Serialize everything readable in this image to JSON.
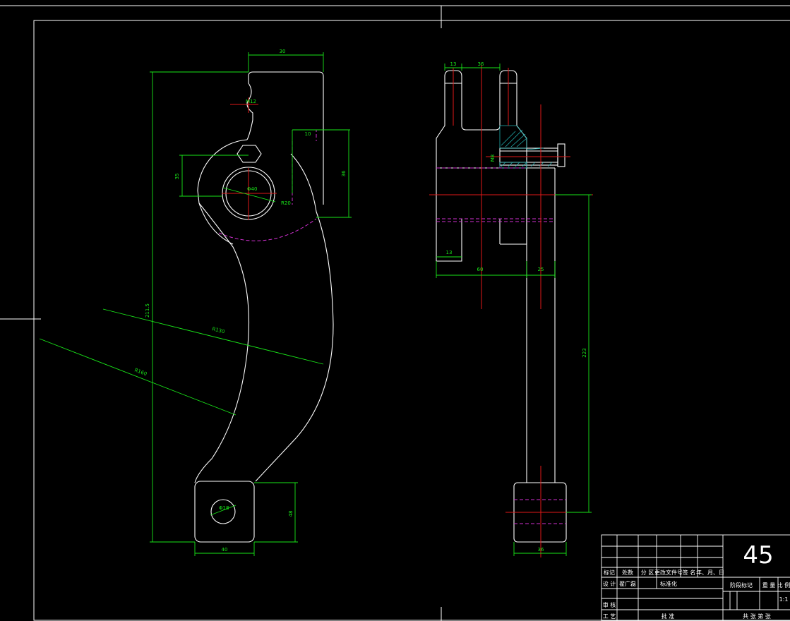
{
  "colors": {
    "background": "#000000",
    "outline": "#ffffff",
    "dimension": "#19e619",
    "centerline": "#e01818",
    "hidden": "#d030d0",
    "hatch": "#20b0b0"
  },
  "front_view": {
    "dims": {
      "top_width": "30",
      "height_overall": "211.5",
      "slot_depth": "10",
      "slot_height": "36",
      "bore_offset": "35",
      "bore_dia": "Φ40",
      "bore_r": "R20",
      "hole_m": "M12",
      "radius_arc_1": "R130",
      "radius_arc_2": "R160",
      "pad_height": "48",
      "pad_width": "40",
      "pad_hole": "Φ18"
    }
  },
  "side_view": {
    "dims": {
      "ear_width": "13",
      "gap_width": "36",
      "fork_width": "60",
      "shank_width": "25",
      "thread": "M8",
      "base_width": "13",
      "shank_length": "223",
      "pad_width": "36"
    }
  },
  "title_block": {
    "material": "45",
    "header_labels": [
      "标记",
      "处数",
      "分 区",
      "更改文件号",
      "签 名",
      "年、月、日"
    ],
    "design_label": "设 计",
    "designer": "翟广磊",
    "standardization": "标准化",
    "review": "审 核",
    "process": "工 艺",
    "approve": "批 准",
    "stage_label": "阶段标记",
    "weight_label": "重 量",
    "scale_label": "比 例",
    "scale_value": "1:1",
    "sheet_text": "共  张  第  张"
  }
}
